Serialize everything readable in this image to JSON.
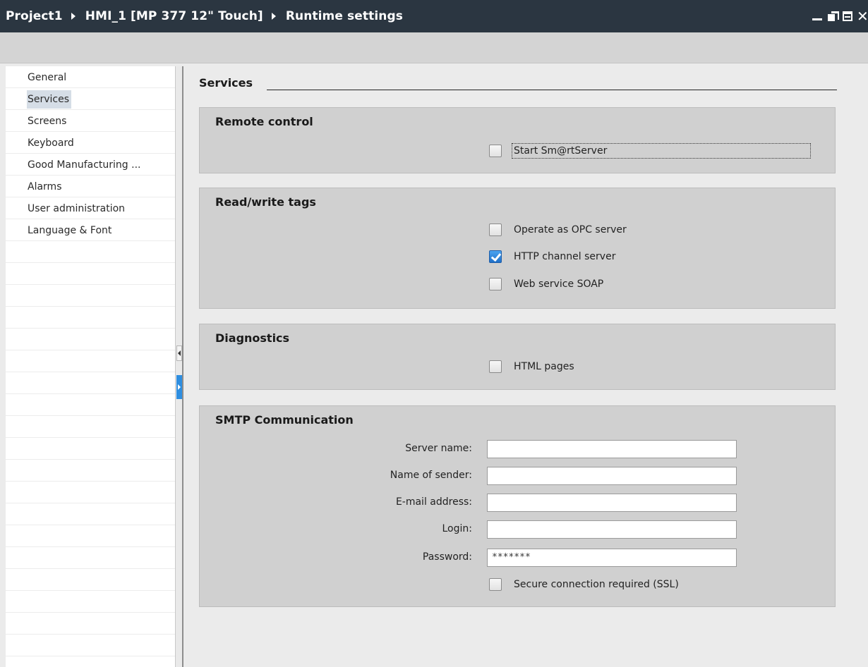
{
  "titlebar": {
    "breadcrumb": [
      "Project1",
      "HMI_1 [MP 377 12\" Touch]",
      "Runtime settings"
    ]
  },
  "sidebar": {
    "items": [
      {
        "label": "General"
      },
      {
        "label": "Services",
        "selected": true
      },
      {
        "label": "Screens"
      },
      {
        "label": "Keyboard"
      },
      {
        "label": "Good Manufacturing ..."
      },
      {
        "label": "Alarms"
      },
      {
        "label": "User administration"
      },
      {
        "label": "Language & Font"
      }
    ]
  },
  "main": {
    "title": "Services",
    "remote_control": {
      "title": "Remote control",
      "start_smartserver": {
        "label": "Start Sm@rtServer",
        "checked": false
      }
    },
    "read_write_tags": {
      "title": "Read/write tags",
      "opc_server": {
        "label": "Operate as OPC server",
        "checked": false
      },
      "http_channel": {
        "label": "HTTP channel server",
        "checked": true
      },
      "web_service_soap": {
        "label": "Web service SOAP",
        "checked": false
      }
    },
    "diagnostics": {
      "title": "Diagnostics",
      "html_pages": {
        "label": "HTML pages",
        "checked": false
      }
    },
    "smtp": {
      "title": "SMTP Communication",
      "server_name": {
        "label": "Server name:",
        "value": ""
      },
      "sender_name": {
        "label": "Name of sender:",
        "value": ""
      },
      "email": {
        "label": "E-mail address:",
        "value": ""
      },
      "login": {
        "label": "Login:",
        "value": ""
      },
      "password": {
        "label": "Password:",
        "value": "*******"
      },
      "ssl": {
        "label": "Secure connection required (SSL)",
        "checked": false
      }
    }
  },
  "colors": {
    "titlebar": "#2b3641",
    "section_bg": "#d0d0d0",
    "selected_item": "#d5dde6",
    "accent": "#2e8ee0"
  },
  "icons": [
    "breadcrumb-arrow-icon",
    "minimize-icon",
    "float-icon",
    "maximize-icon",
    "close-icon",
    "collapse-left-icon",
    "expand-right-icon",
    "checkmark-icon"
  ]
}
